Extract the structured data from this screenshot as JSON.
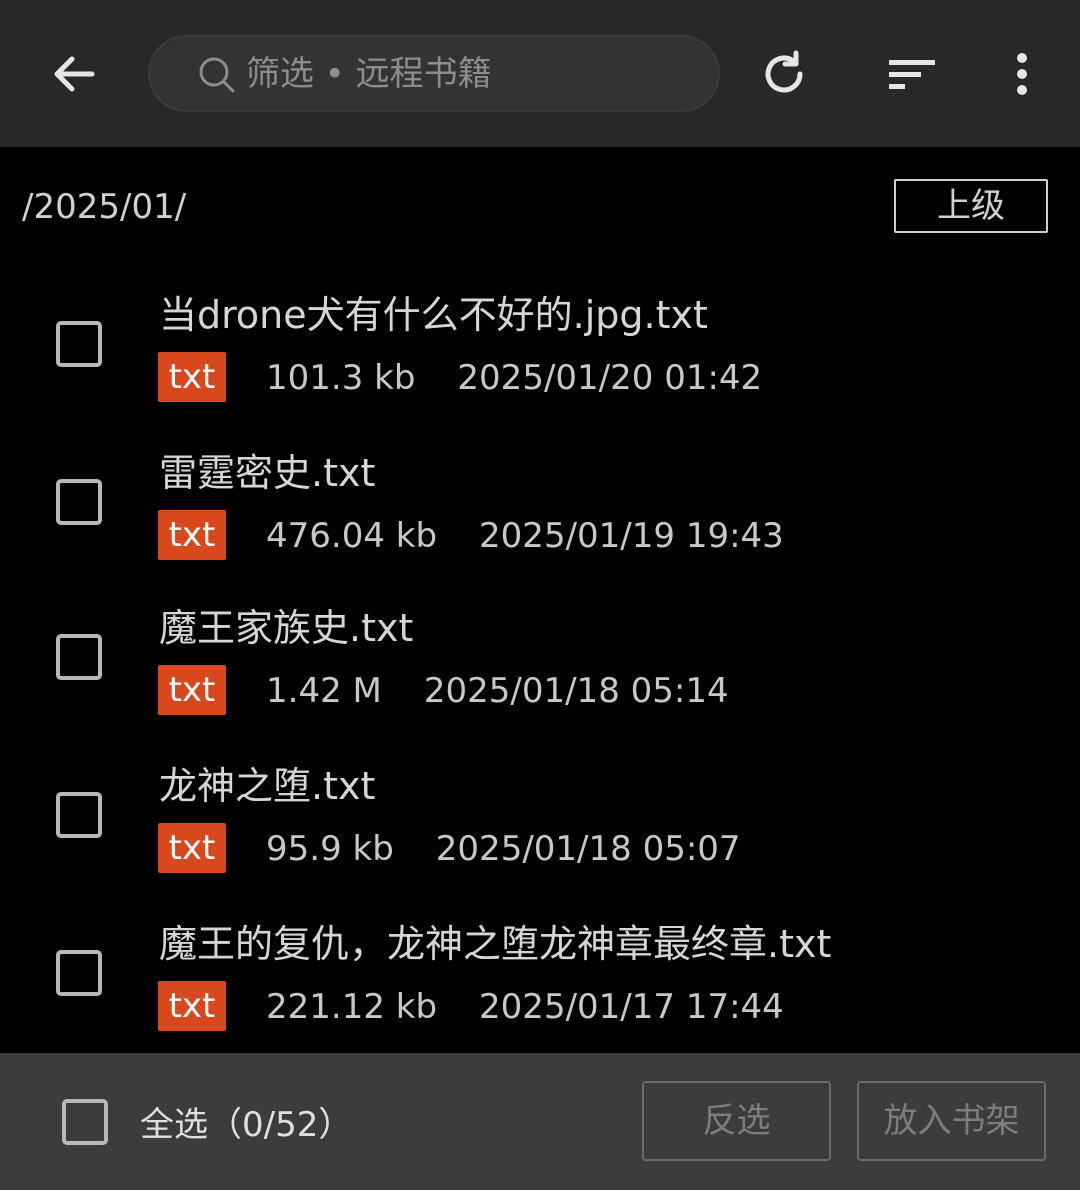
{
  "header": {
    "back_icon": "arrow-left-icon",
    "search": {
      "placeholder": "筛选 • 远程书籍",
      "icon": "search-icon"
    },
    "refresh_icon": "refresh-icon",
    "sort_icon": "sort-icon",
    "menu_icon": "more-vertical-icon"
  },
  "path": {
    "current": "/2025/01/",
    "up_label": "上级"
  },
  "files": [
    {
      "name": "当drone犬有什么不好的.jpg.txt",
      "type": "txt",
      "size": "101.3 kb",
      "date": "2025/01/20 01:42",
      "checked": false
    },
    {
      "name": "雷霆密史.txt",
      "type": "txt",
      "size": "476.04 kb",
      "date": "2025/01/19 19:43",
      "checked": false
    },
    {
      "name": "魔王家族史.txt",
      "type": "txt",
      "size": "1.42 M",
      "date": "2025/01/18 05:14",
      "checked": false
    },
    {
      "name": "龙神之堕.txt",
      "type": "txt",
      "size": "95.9 kb",
      "date": "2025/01/18 05:07",
      "checked": false
    },
    {
      "name": "魔王的复仇，龙神之堕龙神章最终章.txt",
      "type": "txt",
      "size": "221.12 kb",
      "date": "2025/01/17 17:44",
      "checked": false
    }
  ],
  "footer": {
    "select_all_label": "全选（0/52）",
    "invert_label": "反选",
    "add_shelf_label": "放入书架"
  },
  "colors": {
    "badge": "#d9481d",
    "topbar": "#282828",
    "bottombar": "#3c3c3c"
  }
}
